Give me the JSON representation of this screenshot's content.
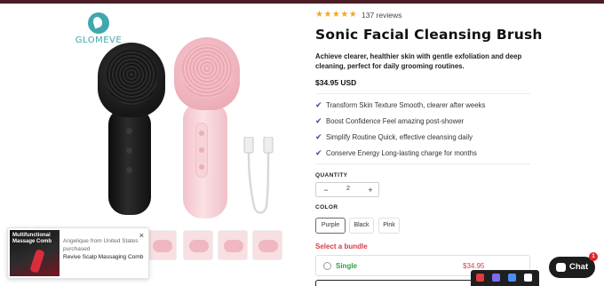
{
  "brand": {
    "logo_text": "GLOMEVE"
  },
  "product": {
    "rating_stars": "★★★★★",
    "reviews": "137 reviews",
    "title": "Sonic Facial Cleansing Brush",
    "description": "Achieve clearer, healthier skin with gentle exfoliation and deep cleaning, perfect for daily grooming routines.",
    "price": "$34.95 USD",
    "benefits": [
      "Transform Skin Texture Smooth, clearer after weeks",
      "Boost Confidence Feel amazing post-shower",
      "Simplify Routine Quick, effective cleansing daily",
      "Conserve Energy Long-lasting charge for months"
    ],
    "quantity_label": "QUANTITY",
    "quantity": {
      "minus": "−",
      "value": "2",
      "plus": "+"
    },
    "color_label": "COLOR",
    "colors": [
      "Purple",
      "Black",
      "Pink"
    ],
    "selected_color": "Purple",
    "bundle_label": "Select a bundle",
    "bundle": {
      "name": "Single",
      "price": "$34.95"
    }
  },
  "popup": {
    "image_title": "Multifunctional Massage Comb",
    "text": "Angelique from United States purchased",
    "product": "Revive Scalp Massaging Comb",
    "close": "×"
  },
  "chat": {
    "label": "Chat",
    "badge": "1"
  },
  "colors": {
    "accent": "#d43c4a",
    "check": "#4a3fa8",
    "bundle_name": "#2f9e44",
    "star": "#f5a623",
    "logo": "#3fa7ad"
  }
}
